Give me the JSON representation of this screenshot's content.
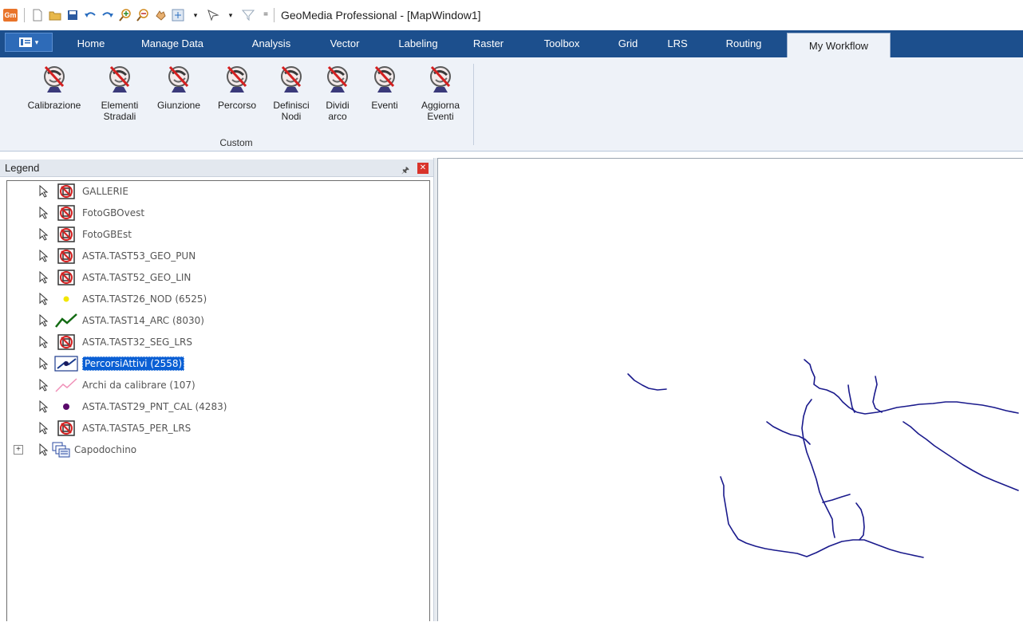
{
  "title_bar": {
    "app_icon_text": "Gm",
    "title": "GeoMedia Professional - [MapWindow1]"
  },
  "tabs": [
    {
      "label": "Home",
      "active": false
    },
    {
      "label": "Manage Data",
      "active": false
    },
    {
      "label": "Analysis",
      "active": false
    },
    {
      "label": "Vector",
      "active": false
    },
    {
      "label": "Labeling",
      "active": false
    },
    {
      "label": "Raster",
      "active": false
    },
    {
      "label": "Toolbox",
      "active": false
    },
    {
      "label": "Grid",
      "active": false
    },
    {
      "label": "LRS",
      "active": false
    },
    {
      "label": "Routing",
      "active": false
    },
    {
      "label": "My Workflow",
      "active": true
    }
  ],
  "ribbon": {
    "group_label": "Custom",
    "buttons": [
      {
        "line1": "Calibrazione",
        "line2": ""
      },
      {
        "line1": "Elementi",
        "line2": "Stradali"
      },
      {
        "line1": "Giunzione",
        "line2": ""
      },
      {
        "line1": "Percorso",
        "line2": ""
      },
      {
        "line1": "Definisci",
        "line2": "Nodi"
      },
      {
        "line1": "Dividi",
        "line2": "arco"
      },
      {
        "line1": "Eventi",
        "line2": ""
      },
      {
        "line1": "Aggiorna",
        "line2": "Eventi"
      }
    ]
  },
  "legend": {
    "title": "Legend",
    "pin_icon": "pin-icon",
    "close_icon": "close-icon",
    "entries": [
      {
        "label": "GALLERIE",
        "symbol": "unavailable-icon"
      },
      {
        "label": "FotoGBOvest",
        "symbol": "unavailable-icon"
      },
      {
        "label": "FotoGBEst",
        "symbol": "unavailable-icon"
      },
      {
        "label": "ASTA.TAST53_GEO_PUN",
        "symbol": "unavailable-icon"
      },
      {
        "label": "ASTA.TAST52_GEO_LIN",
        "symbol": "unavailable-icon"
      },
      {
        "label": "ASTA.TAST26_NOD (6525)",
        "symbol": "yellow-point-icon"
      },
      {
        "label": "ASTA.TAST14_ARC (8030)",
        "symbol": "green-line-icon"
      },
      {
        "label": "ASTA.TAST32_SEG_LRS",
        "symbol": "unavailable-icon"
      },
      {
        "label": "PercorsiAttivi (2558)",
        "symbol": "blue-route-icon",
        "selected": true
      },
      {
        "label": "Archi da calibrare (107)",
        "symbol": "pink-line-icon"
      },
      {
        "label": "ASTA.TAST29_PNT_CAL (4283)",
        "symbol": "purple-point-icon"
      },
      {
        "label": "ASTA.TASTA5_PER_LRS",
        "symbol": "unavailable-icon"
      },
      {
        "label": "Capodochino",
        "symbol": "group-icon",
        "expander": "+"
      }
    ]
  },
  "map": {
    "window": "MapWindow1",
    "feature_color": "#1a1a8c"
  }
}
